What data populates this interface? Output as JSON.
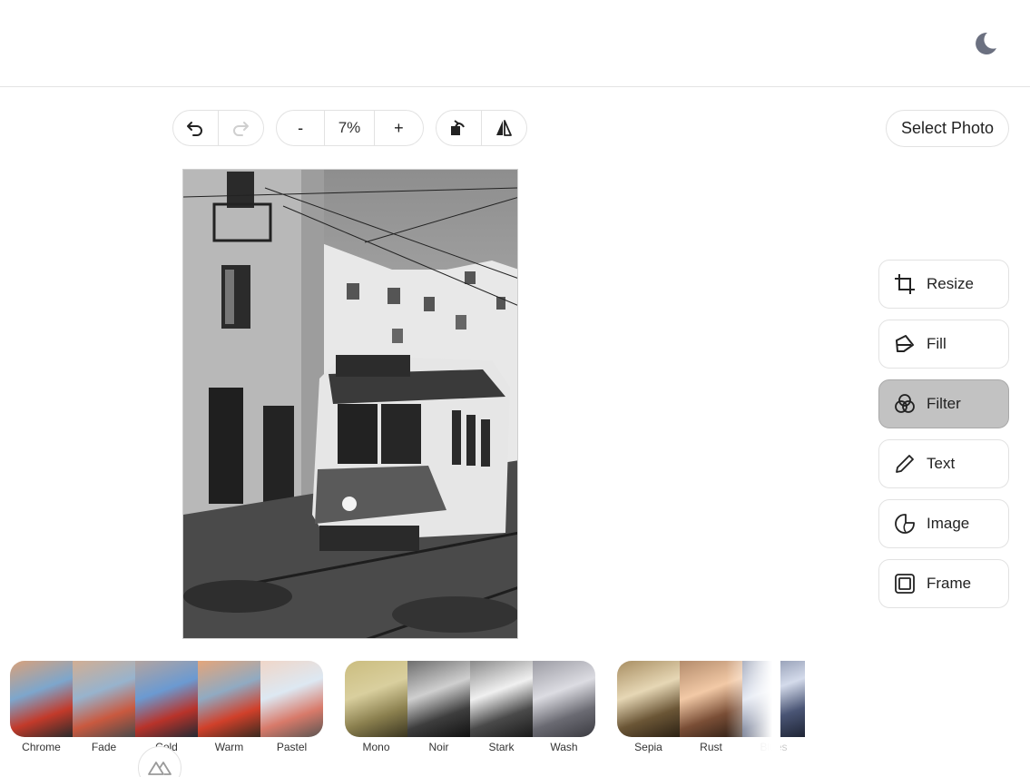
{
  "toolbar": {
    "zoom_value": "7%",
    "zoom_out_label": "-",
    "zoom_in_label": "+",
    "select_photo_label": "Select Photo"
  },
  "tools": [
    {
      "label": "Resize",
      "icon": "crop-icon"
    },
    {
      "label": "Fill",
      "icon": "fill-bucket-icon"
    },
    {
      "label": "Filter",
      "icon": "filter-circles-icon",
      "active": true
    },
    {
      "label": "Text",
      "icon": "pencil-icon"
    },
    {
      "label": "Image",
      "icon": "sticker-icon"
    },
    {
      "label": "Frame",
      "icon": "frame-icon"
    }
  ],
  "filters": {
    "group1": [
      "Chrome",
      "Fade",
      "Cold",
      "Warm",
      "Pastel"
    ],
    "group2": [
      "Mono",
      "Noir",
      "Stark",
      "Wash"
    ],
    "group3": [
      "Sepia",
      "Rust",
      "Blues"
    ]
  },
  "colors": {
    "active_tool_bg": "#c2c2c2",
    "border": "#e2e2e2",
    "moon_icon": "#6b7080"
  },
  "icons": {
    "theme_toggle": "moon-icon",
    "undo": "undo-icon",
    "redo": "redo-icon",
    "rotate": "rotate-icon",
    "flip": "flip-horizontal-icon",
    "footer_badge": "nuxt-logo-icon"
  }
}
